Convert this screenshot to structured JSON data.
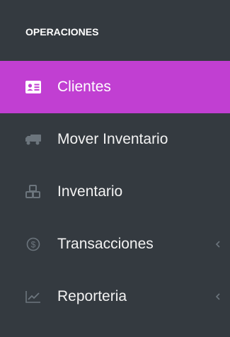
{
  "sidebar": {
    "section_title": "OPERACIONES",
    "items": [
      {
        "label": "Clientes",
        "icon": "address-card-icon",
        "active": true,
        "has_submenu": false
      },
      {
        "label": "Mover Inventario",
        "icon": "truck-icon",
        "active": false,
        "has_submenu": false
      },
      {
        "label": "Inventario",
        "icon": "boxes-icon",
        "active": false,
        "has_submenu": false
      },
      {
        "label": "Transacciones",
        "icon": "dollar-circle-icon",
        "active": false,
        "has_submenu": true
      },
      {
        "label": "Reporteria",
        "icon": "line-chart-icon",
        "active": false,
        "has_submenu": true
      }
    ]
  },
  "colors": {
    "background": "#343a40",
    "active_item": "#c13fd2",
    "icon_muted": "#6c757d",
    "text": "#ffffff"
  }
}
